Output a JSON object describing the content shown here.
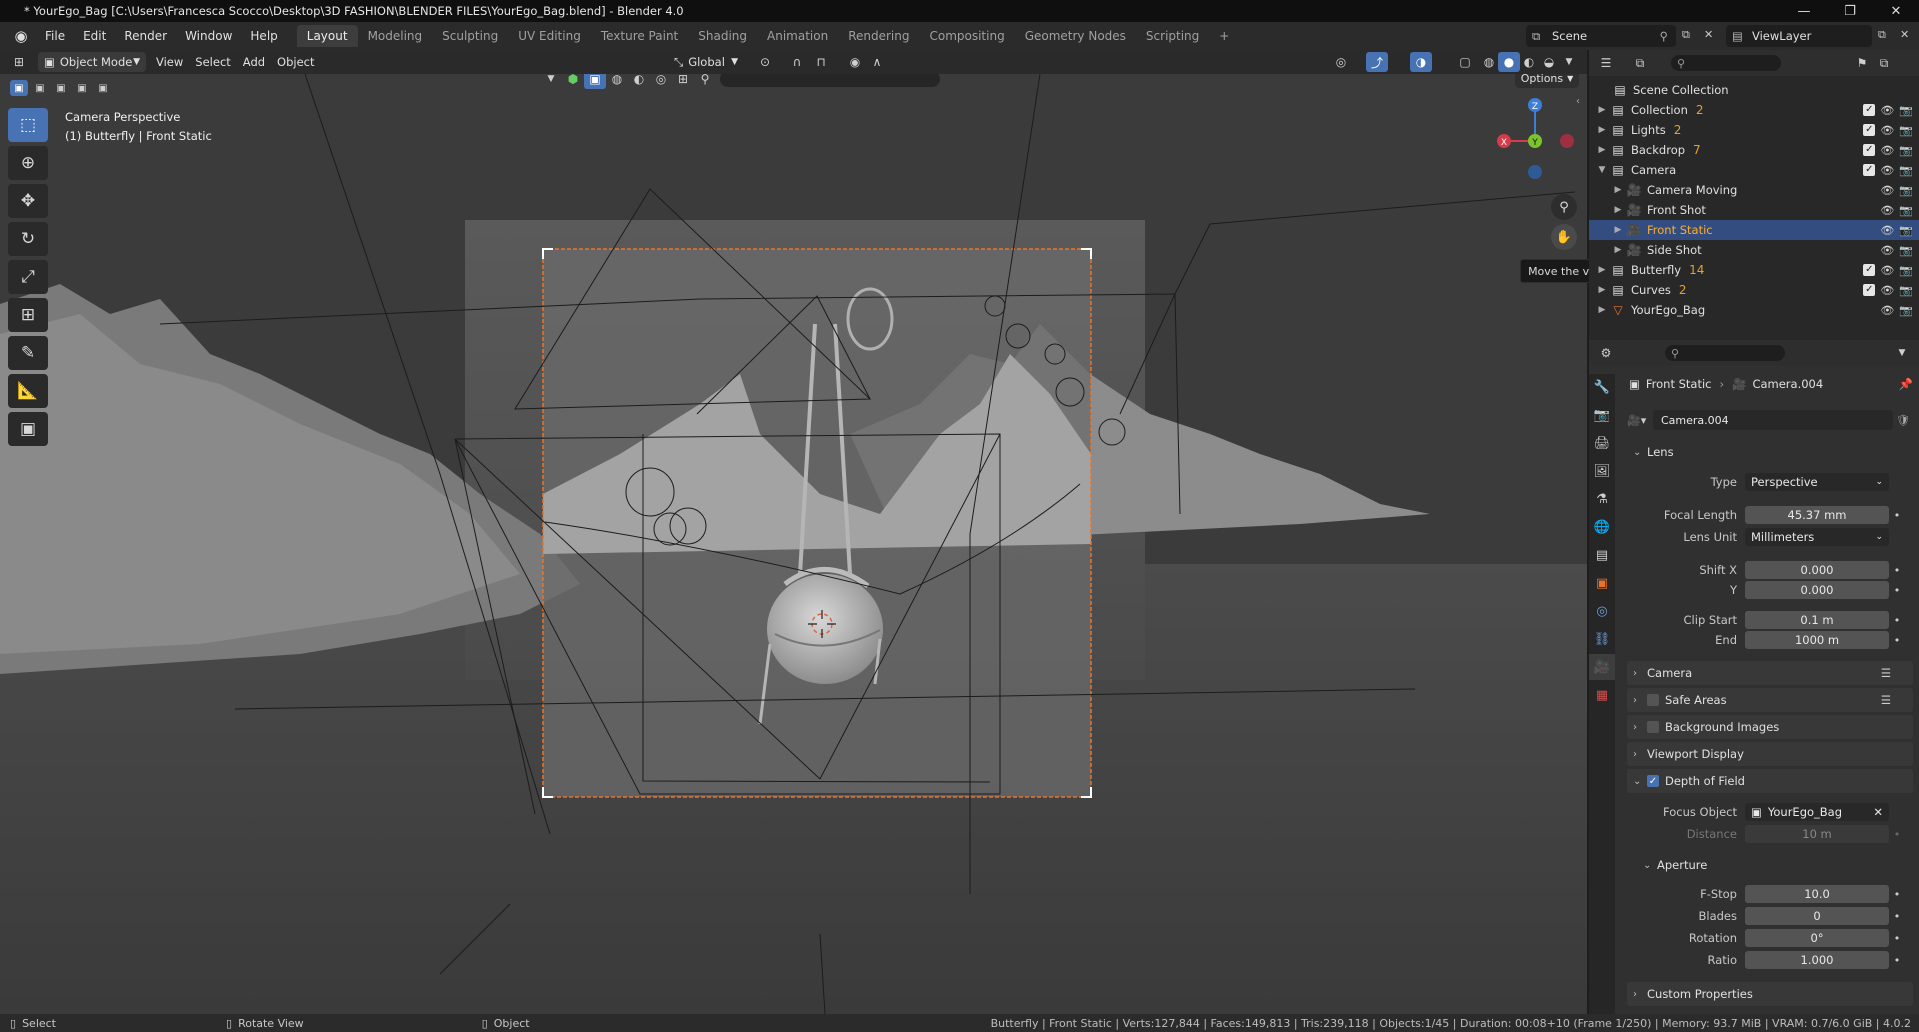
{
  "window": {
    "title": "* YourEgo_Bag [C:\\Users\\Francesca Scocco\\Desktop\\3D FASHION\\BLENDER FILES\\YourEgo_Bag.blend] - Blender 4.0"
  },
  "menu": [
    "File",
    "Edit",
    "Render",
    "Window",
    "Help"
  ],
  "workspaces": [
    "Layout",
    "Modeling",
    "Sculpting",
    "UV Editing",
    "Texture Paint",
    "Shading",
    "Animation",
    "Rendering",
    "Compositing",
    "Geometry Nodes",
    "Scripting"
  ],
  "active_workspace": "Layout",
  "scene": {
    "name": "Scene",
    "view_layer": "ViewLayer"
  },
  "viewport_header": {
    "mode": "Object Mode",
    "menus": [
      "View",
      "Select",
      "Add",
      "Object"
    ],
    "orientation": "Global",
    "options_label": "Options"
  },
  "viewport": {
    "camera_label": "Camera Perspective",
    "object_label": "(1) Butterfly | Front Static",
    "tooltip": "Move the view",
    "gizmo": {
      "x": "X",
      "y": "Y",
      "z": "Z"
    }
  },
  "outliner": {
    "root": "Scene Collection",
    "items": [
      {
        "label": "Collection",
        "level": 0,
        "expanded": false,
        "extra": "2"
      },
      {
        "label": "Lights",
        "level": 0,
        "expanded": false,
        "extra": "2"
      },
      {
        "label": "Backdrop",
        "level": 0,
        "expanded": false,
        "extra": "7"
      },
      {
        "label": "Camera",
        "level": 0,
        "expanded": true,
        "extra": ""
      },
      {
        "label": "Camera Moving",
        "level": 1,
        "expanded": false,
        "extra": ""
      },
      {
        "label": "Front Shot",
        "level": 1,
        "expanded": false,
        "extra": ""
      },
      {
        "label": "Front Static",
        "level": 1,
        "expanded": false,
        "extra": "",
        "selected": true
      },
      {
        "label": "Side Shot",
        "level": 1,
        "expanded": false,
        "extra": ""
      },
      {
        "label": "Butterfly",
        "level": 0,
        "expanded": false,
        "extra": "14"
      },
      {
        "label": "Curves",
        "level": 0,
        "expanded": false,
        "extra": "2"
      },
      {
        "label": "YourEgo_Bag",
        "level": 0,
        "expanded": false,
        "extra": ""
      }
    ]
  },
  "properties": {
    "breadcrumb_object": "Front Static",
    "breadcrumb_data": "Camera.004",
    "datablock": "Camera.004",
    "lens": {
      "title": "Lens",
      "type_label": "Type",
      "type_value": "Perspective",
      "focal_label": "Focal Length",
      "focal_value": "45.37 mm",
      "unit_label": "Lens Unit",
      "unit_value": "Millimeters",
      "shiftx_label": "Shift X",
      "shiftx_value": "0.000",
      "shifty_label": "Y",
      "shifty_value": "0.000",
      "clipstart_label": "Clip Start",
      "clipstart_value": "0.1 m",
      "clipend_label": "End",
      "clipend_value": "1000 m"
    },
    "panels": {
      "camera": "Camera",
      "safe_areas": "Safe Areas",
      "background_images": "Background Images",
      "viewport_display": "Viewport Display",
      "dof": "Depth of Field",
      "aperture": "Aperture",
      "custom_props": "Custom Properties"
    },
    "dof": {
      "focus_label": "Focus Object",
      "focus_value": "YourEgo_Bag",
      "distance_label": "Distance",
      "distance_value": "10 m"
    },
    "aperture": {
      "fstop_label": "F-Stop",
      "fstop_value": "10.0",
      "blades_label": "Blades",
      "blades_value": "0",
      "rotation_label": "Rotation",
      "rotation_value": "0°",
      "ratio_label": "Ratio",
      "ratio_value": "1.000"
    }
  },
  "statusbar": {
    "select": "Select",
    "rotate": "Rotate View",
    "object": "Object",
    "stats": "Butterfly | Front Static | Verts:127,844 | Faces:149,813 | Tris:239,118 | Objects:1/45 | Duration: 00:08+10 (Frame 1/250) | Memory: 93.7 MiB | VRAM: 0.7/6.0 GiB | 4.0.2"
  },
  "colors": {
    "accent_blue": "#4772b3",
    "selected_row": "#334d80",
    "camera_frame": "#e8742b",
    "axis_x": "#d63b4a",
    "axis_y": "#7cc42b",
    "axis_z": "#3d7fd6"
  }
}
